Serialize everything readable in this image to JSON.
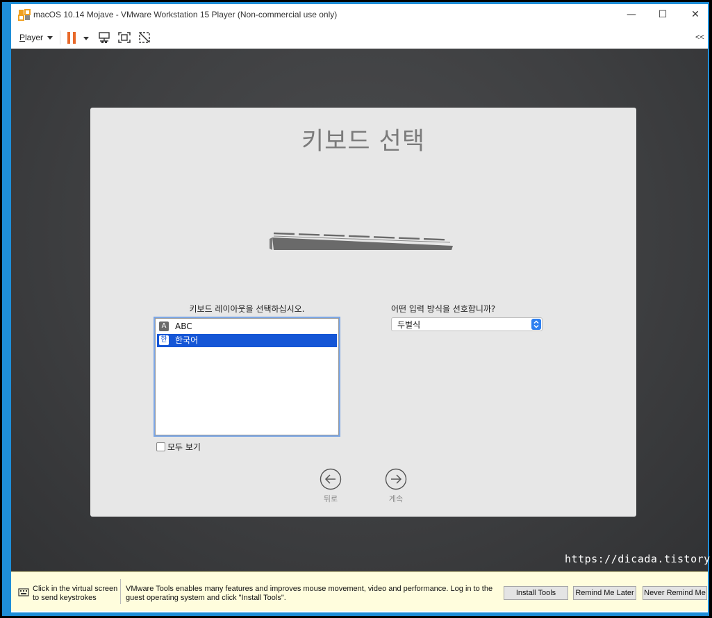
{
  "window": {
    "title": "macOS 10.14 Mojave - VMware Workstation 15 Player (Non-commercial use only)",
    "min_glyph": "—",
    "max_glyph": "☐",
    "close_glyph": "✕"
  },
  "toolbar": {
    "player_first": "P",
    "player_rest": "layer",
    "collapse": "<<"
  },
  "dialog": {
    "title": "키보드 선택",
    "layout_label": "키보드 레이아웃을 선택하십시오.",
    "layouts": [
      {
        "badge": "A",
        "label": "ABC",
        "selected": false
      },
      {
        "badge": "한",
        "label": "한국어",
        "selected": true
      }
    ],
    "show_all_label": "모두 보기",
    "input_label": "어떤 입력 방식을 선호합니까?",
    "input_value": "두벌식",
    "back_label": "뒤로",
    "next_label": "계속"
  },
  "watermark": "https://dicada.tistory.com",
  "notification": {
    "click_hint": "Click in the virtual screen to send keystrokes",
    "message": "VMware Tools enables many features and improves mouse movement, video and performance. Log in to the guest operating system and click \"Install Tools\".",
    "install_tools": "Install Tools",
    "remind_later": "Remind Me Later",
    "never_remind": "Never Remind Me"
  },
  "colors": {
    "frame": "#1e8ed8",
    "selection": "#1556d6",
    "pause": "#e8692a",
    "notification_bg": "#fffddd"
  }
}
